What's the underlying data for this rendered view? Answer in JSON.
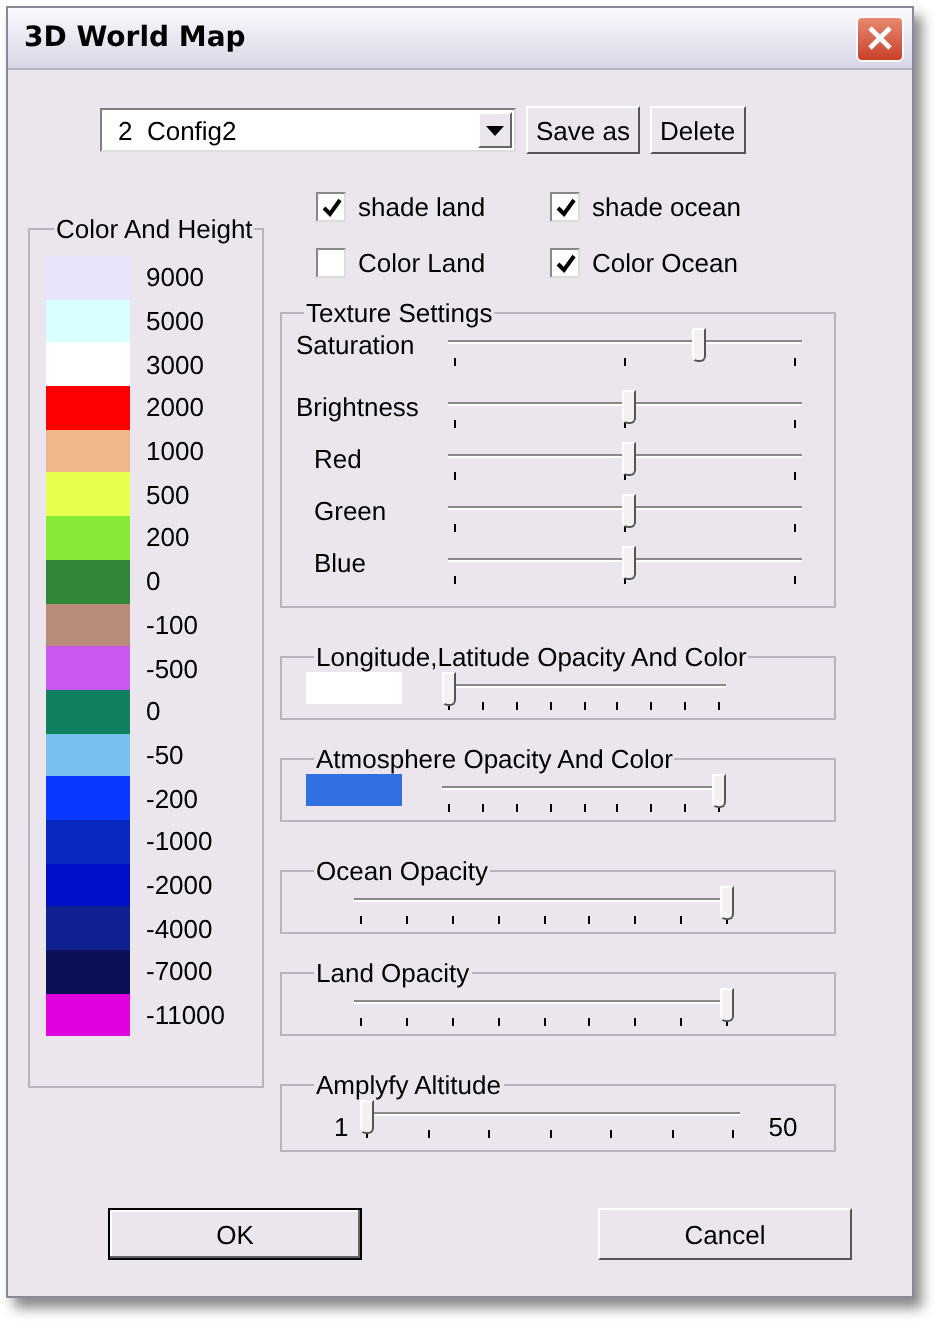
{
  "window": {
    "title": "3D World Map"
  },
  "config": {
    "value": "2  Config2",
    "buttons": [
      "Save as",
      "Delete"
    ]
  },
  "checkboxes": [
    {
      "label": "shade land",
      "checked": true
    },
    {
      "label": "shade ocean",
      "checked": true
    },
    {
      "label": "Color Land",
      "checked": false
    },
    {
      "label": "Color Ocean",
      "checked": true
    }
  ],
  "color_and_height": {
    "title": "Color And Height",
    "entries": [
      {
        "label": "9000",
        "color": "#e8e4fc"
      },
      {
        "label": "5000",
        "color": "#d8feff"
      },
      {
        "label": "3000",
        "color": "#ffffff"
      },
      {
        "label": "2000",
        "color": "#ff0000"
      },
      {
        "label": "1000",
        "color": "#f0b88a"
      },
      {
        "label": "500",
        "color": "#e8ff50"
      },
      {
        "label": "200",
        "color": "#88e838"
      },
      {
        "label": "0",
        "color": "#308838"
      },
      {
        "label": "-100",
        "color": "#b88c78"
      },
      {
        "label": "-500",
        "color": "#c858f0"
      },
      {
        "label": "0",
        "color": "#108060"
      },
      {
        "label": "-50",
        "color": "#78c0f0"
      },
      {
        "label": "-200",
        "color": "#0838ff"
      },
      {
        "label": "-1000",
        "color": "#0828c0"
      },
      {
        "label": "-2000",
        "color": "#0010c8"
      },
      {
        "label": "-4000",
        "color": "#102090"
      },
      {
        "label": "-7000",
        "color": "#0c1058"
      },
      {
        "label": "-11000",
        "color": "#e000e0"
      }
    ]
  },
  "texture_settings": {
    "title": "Texture Settings",
    "sliders": [
      {
        "label": "Saturation",
        "level": 0.72,
        "indent": false
      },
      {
        "label": "Brightness",
        "level": 0.51,
        "indent": false
      },
      {
        "label": "Red",
        "level": 0.51,
        "indent": true
      },
      {
        "label": "Green",
        "level": 0.51,
        "indent": true
      },
      {
        "label": "Blue",
        "level": 0.51,
        "indent": true
      }
    ]
  },
  "groups": [
    {
      "title": "Longitude,Latitude Opacity And Color",
      "color": "#ffffff",
      "level": 0
    },
    {
      "title": "Atmosphere Opacity And Color",
      "color": "#3070e0",
      "level": 1
    },
    {
      "title": "Ocean Opacity",
      "level": 1
    },
    {
      "title": "Land Opacity",
      "level": 1
    },
    {
      "title": "Amplyfy Altitude",
      "level": 0,
      "min": "1",
      "max": "50"
    }
  ],
  "buttons": [
    "OK",
    "Cancel"
  ]
}
